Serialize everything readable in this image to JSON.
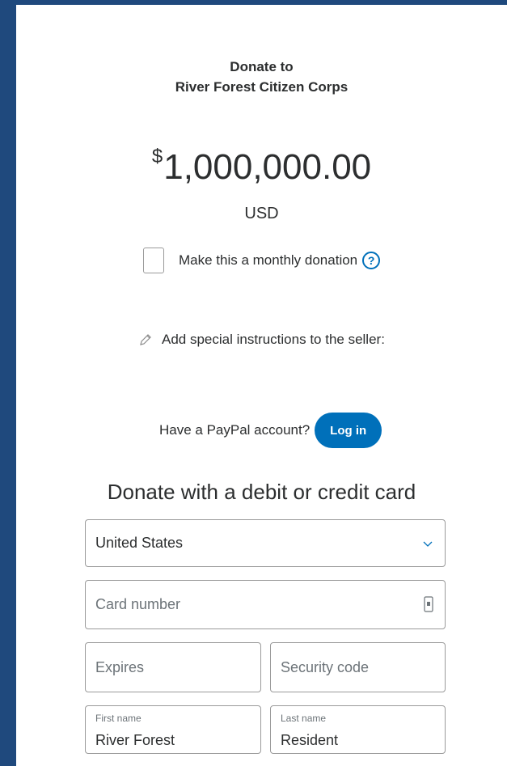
{
  "header": {
    "line1": "Donate to",
    "line2": "River Forest Citizen Corps"
  },
  "amount": {
    "symbol": "$",
    "value": "1,000,000.00",
    "currency": "USD"
  },
  "monthly": {
    "label": "Make this a monthly donation",
    "help_glyph": "?",
    "checked": false
  },
  "instructions": {
    "label": "Add special instructions to the seller:"
  },
  "login": {
    "prompt": "Have a PayPal account?",
    "button_label": "Log in"
  },
  "card_form": {
    "title": "Donate with a debit or credit card",
    "country": "United States",
    "card_number_placeholder": "Card number",
    "expires_placeholder": "Expires",
    "security_code_placeholder": "Security code",
    "first_name_label": "First name",
    "first_name_value": "River Forest",
    "last_name_label": "Last name",
    "last_name_value": "Resident"
  },
  "colors": {
    "background": "#1f497d",
    "accent": "#0070ba"
  },
  "icons": {
    "help": "question-circle-icon",
    "pencil": "pencil-icon",
    "chevron": "chevron-down-icon",
    "card": "card-icon"
  }
}
